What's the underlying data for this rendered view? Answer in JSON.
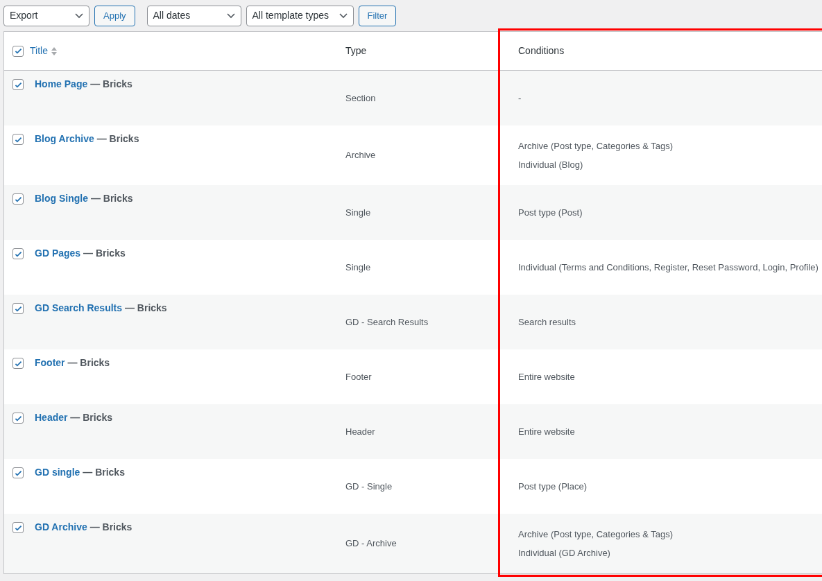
{
  "toolbar": {
    "bulk_action": "Export",
    "apply": "Apply",
    "date_filter": "All dates",
    "type_filter": "All template types",
    "filter": "Filter"
  },
  "table": {
    "select_all_checked": true,
    "columns": [
      "Title",
      "Type",
      "Conditions"
    ],
    "rows": [
      {
        "checked": true,
        "title": "Home Page",
        "suffix": "— Bricks",
        "type": "Section",
        "conditions": [
          "-"
        ]
      },
      {
        "checked": true,
        "title": "Blog Archive",
        "suffix": "— Bricks",
        "type": "Archive",
        "conditions": [
          "Archive (Post type, Categories & Tags)",
          "Individual (Blog)"
        ]
      },
      {
        "checked": true,
        "title": "Blog Single",
        "suffix": "— Bricks",
        "type": "Single",
        "conditions": [
          "Post type (Post)"
        ]
      },
      {
        "checked": true,
        "title": "GD Pages",
        "suffix": "— Bricks",
        "type": "Single",
        "conditions": [
          "Individual (Terms and Conditions, Register, Reset Password, Login, Profile)"
        ]
      },
      {
        "checked": true,
        "title": "GD Search Results",
        "suffix": "— Bricks",
        "type": "GD - Search Results",
        "conditions": [
          "Search results"
        ]
      },
      {
        "checked": true,
        "title": "Footer",
        "suffix": "— Bricks",
        "type": "Footer",
        "conditions": [
          "Entire website"
        ]
      },
      {
        "checked": true,
        "title": "Header",
        "suffix": "— Bricks",
        "type": "Header",
        "conditions": [
          "Entire website"
        ]
      },
      {
        "checked": true,
        "title": "GD single",
        "suffix": "— Bricks",
        "type": "GD - Single",
        "conditions": [
          "Post type (Place)"
        ]
      },
      {
        "checked": true,
        "title": "GD Archive",
        "suffix": "— Bricks",
        "type": "GD - Archive",
        "conditions": [
          "Archive (Post type, Categories & Tags)",
          "Individual (GD Archive)"
        ]
      }
    ]
  }
}
